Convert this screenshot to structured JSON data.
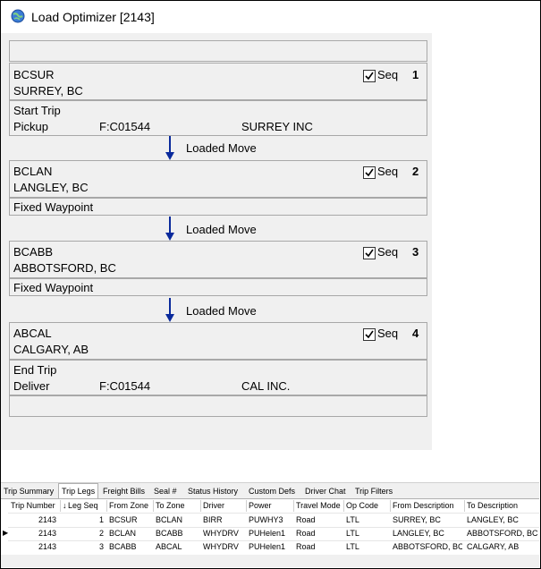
{
  "window": {
    "title": "Load Optimizer [2143]"
  },
  "stops": [
    {
      "zone": "BCSUR",
      "city": "SURREY, BC",
      "seq_label": "Seq",
      "seq_checked": true,
      "seq_number": "1"
    },
    {
      "zone": "BCLAN",
      "city": "LANGLEY, BC",
      "seq_label": "Seq",
      "seq_checked": true,
      "seq_number": "2"
    },
    {
      "zone": "BCABB",
      "city": "ABBOTSFORD, BC",
      "seq_label": "Seq",
      "seq_checked": true,
      "seq_number": "3"
    },
    {
      "zone": "ABCAL",
      "city": "CALGARY, AB",
      "seq_label": "Seq",
      "seq_checked": true,
      "seq_number": "4"
    }
  ],
  "events": {
    "start": {
      "line1": "Start Trip",
      "action": "Pickup",
      "code": "F:C01544",
      "company": "SURREY INC"
    },
    "waypoint1": {
      "line1": "Fixed Waypoint"
    },
    "waypoint2": {
      "line1": "Fixed Waypoint"
    },
    "end": {
      "line1": "End Trip",
      "action": "Deliver",
      "code": "F:C01544",
      "company": "CAL INC."
    }
  },
  "moves": [
    "Loaded Move",
    "Loaded Move",
    "Loaded Move"
  ],
  "tabs": [
    "Trip Summary",
    "Trip Legs",
    "Freight Bills",
    "Seal #",
    "Status History",
    "Custom Defs",
    "Driver Chat",
    "Trip Filters"
  ],
  "active_tab": "Trip Legs",
  "grid": {
    "columns": [
      "Trip Number",
      "Leg Seq",
      "From Zone",
      "To Zone",
      "Driver",
      "Power",
      "Travel Mode",
      "Op Code",
      "From Description",
      "To Description"
    ],
    "rows": [
      [
        "2143",
        "1",
        "BCSUR",
        "BCLAN",
        "BIRR",
        "PUWHY3",
        "Road",
        "LTL",
        "SURREY, BC",
        "LANGLEY, BC"
      ],
      [
        "2143",
        "2",
        "BCLAN",
        "BCABB",
        "WHYDRV",
        "PUHelen1",
        "Road",
        "LTL",
        "LANGLEY, BC",
        "ABBOTSFORD, BC"
      ],
      [
        "2143",
        "3",
        "BCABB",
        "ABCAL",
        "WHYDRV",
        "PUHelen1",
        "Road",
        "LTL",
        "ABBOTSFORD, BC",
        "CALGARY, AB"
      ]
    ]
  },
  "colors": {
    "arrow": "#0a2a9c",
    "panel": "#f0f0f0",
    "border": "#a8a8a8"
  }
}
